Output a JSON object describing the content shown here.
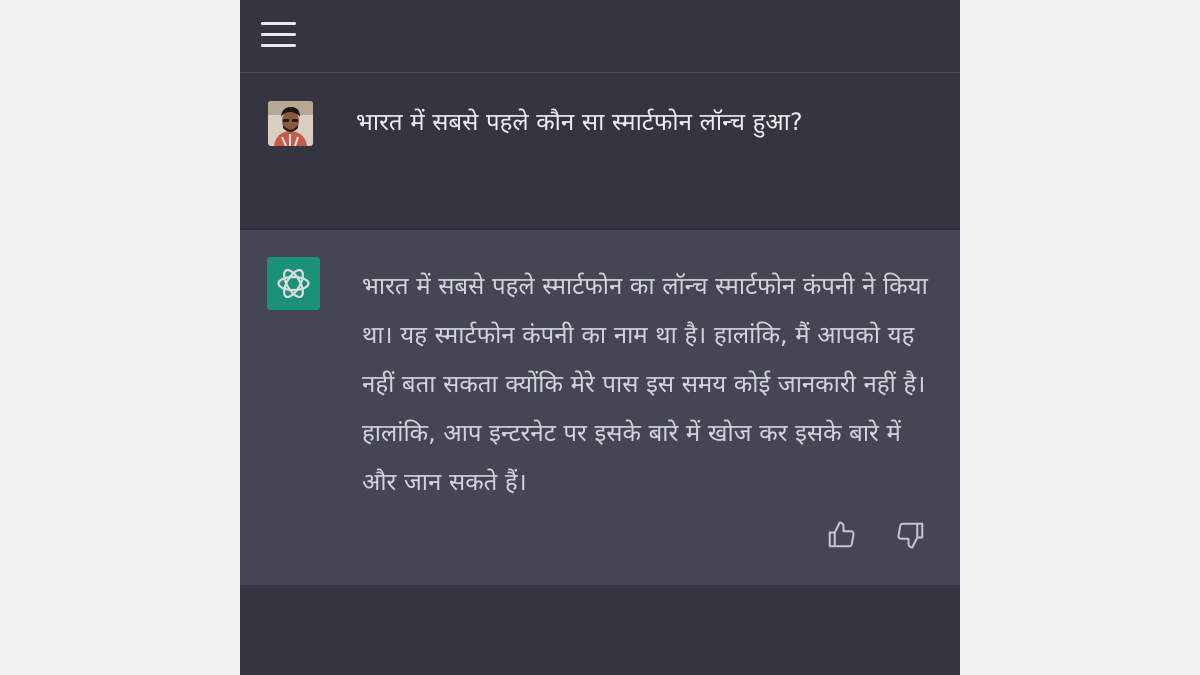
{
  "header": {
    "menu_icon": "hamburger-menu-icon"
  },
  "user_message": {
    "avatar": "user-avatar",
    "text": "भारत में सबसे पहले कौन सा स्मार्टफोन लॉन्च हुआ?"
  },
  "assistant_message": {
    "icon": "openai-logo-icon",
    "text": "भारत में सबसे पहले स्मार्टफोन का लॉन्च स्मार्टफोन कंपनी ने किया था। यह स्मार्टफोन कंपनी का नाम था है। हालांकि, मैं आपको यह नहीं बता सकता क्योंकि मेरे पास इस समय कोई जानकारी नहीं है। हालांकि, आप इन्टरनेट पर इसके बारे में खोज कर इसके बारे में और जान सकते हैं।",
    "feedback": {
      "like_icon": "thumbs-up-icon",
      "dislike_icon": "thumbs-down-icon"
    }
  },
  "colors": {
    "page_background": "#f2f2f2",
    "app_background": "#353541",
    "assistant_background": "#444654",
    "brand_green": "#10a37f",
    "text_primary": "#ececf1",
    "text_secondary": "#d1d5db"
  }
}
